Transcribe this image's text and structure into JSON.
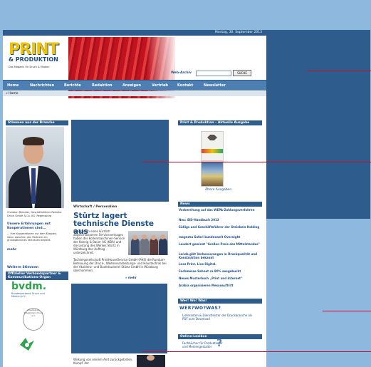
{
  "header": {
    "date": "Montag, 30. September 2013",
    "logo_line1": "PRINT",
    "logo_line2": "& PRODUKTION",
    "tagline": "Das Magazin für Druck & Medien",
    "search_label": "Web-Archiv",
    "search_placeholder": "",
    "search_button": "SUCHE"
  },
  "nav": {
    "items": [
      {
        "label": "Home"
      },
      {
        "label": "Nachrichten"
      },
      {
        "label": "Berichte"
      },
      {
        "label": "Redaktion"
      },
      {
        "label": "Anzeigen"
      },
      {
        "label": "Vertrieb"
      },
      {
        "label": "Kontakt"
      },
      {
        "label": "Newsletter"
      }
    ],
    "breadcrumb": "» Home"
  },
  "left": {
    "heading": "Stimmen aus der Branche",
    "caption": "Christian Reindler, Geschäftsführer Reindler Druck GmbH & Co. KG, Regensburg",
    "teaser": "Unsere Erfahrungen mit Kooperationen sind...",
    "body": "... Ihre Kooperationen nur dem Klappen, wenn zwischen den Partnern ein grundsätzliches Vertrauen besteht.",
    "more": "mehr",
    "link": "Weitere Stimmen",
    "heading2": "Offizieller Verbandspartner & Kommunikations-Organ",
    "bvdm": "bvdm.",
    "bvdm_sub": "Bundesverband Druck und Medien e.V.",
    "seal": "Arbeitskreis Prägefolien Druck e.V."
  },
  "center": {
    "section": "Wirtschaft / Personalien",
    "headline": "Stürtz lagert technische Dienste aus",
    "body1": "Im Rahmen eines kürzlich abgeschlossenen Servicevertrages haben der Rollenmaschinen-Service der Koenig & Bauer AG (KBA) und die Leitung des Werkes Stürtz in Würzburg den Auftrag unterzeichnet.",
    "body2": "Tochtergesellschaft PrintHouseService GmbH (PHS) die Rundum-Betreuung der Druck-, Weiterverarbeitungs- und Haustechnik bei der Akzidenz- und Buchdruckerei Stürtz GmbH in Würzburg übernommen.",
    "more": "» mehr",
    "footer": "Wirkung von seinem Amt zurückgetreten, Kampf, der"
  },
  "right": {
    "heading_issue": "Print & Produktion – Aktuelle Ausgabe",
    "older": "Ältere Ausgaben",
    "heading_news": "News",
    "news": [
      "Vorbereitung auf das WEPA-Zahlungsverfahren",
      "Neu: SID-Handbuch 2013",
      "Süßigs und Geschäftsführer der Steinbeis Holding",
      "magnetu Safari bundesweit Overnight",
      "Laudert gewinnt \"Großen Preis des Mittelstandes\"",
      "Landa gibt Verbesserungen in Druckqualität und Konstruktion bekannt",
      "Leos Print. Live Digital.",
      "Fachmesse Sahnet ca 80% ausgebucht",
      "Neues Musterbuch „Print und Internet\"",
      "Arabia organisieren Messeauftritt"
    ],
    "heading_wer": "Wer! Wo! Was!",
    "wer_logo": "WER?WO?WAS?",
    "wer_text": "Lieferanten & Dienstleister der Druckbranche als PDF zum Download",
    "heading_lex": "Online-Lexikon",
    "lex_text": "Fachbücher für Produktioner und Mediengestalter"
  }
}
